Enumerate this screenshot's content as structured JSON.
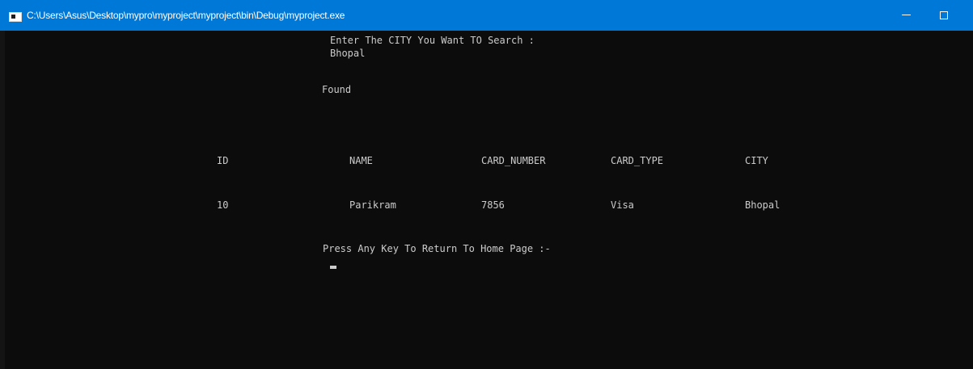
{
  "window": {
    "title": "C:\\Users\\Asus\\Desktop\\mypro\\myproject\\myproject\\bin\\Debug\\myproject.exe"
  },
  "console": {
    "prompt": "Enter The CITY You Want TO Search :",
    "input": "Bhopal",
    "status": "Found",
    "table": {
      "headers": [
        "ID",
        "NAME",
        "CARD_NUMBER",
        "CARD_TYPE",
        "CITY"
      ],
      "rows": [
        [
          "10",
          "Parikram",
          "7856",
          "Visa",
          "Bhopal"
        ]
      ]
    },
    "footer": "Press Any Key To Return To Home Page :-"
  },
  "colors": {
    "titlebar": "#0078d7",
    "background": "#0c0c0c",
    "text": "#cccccc"
  }
}
